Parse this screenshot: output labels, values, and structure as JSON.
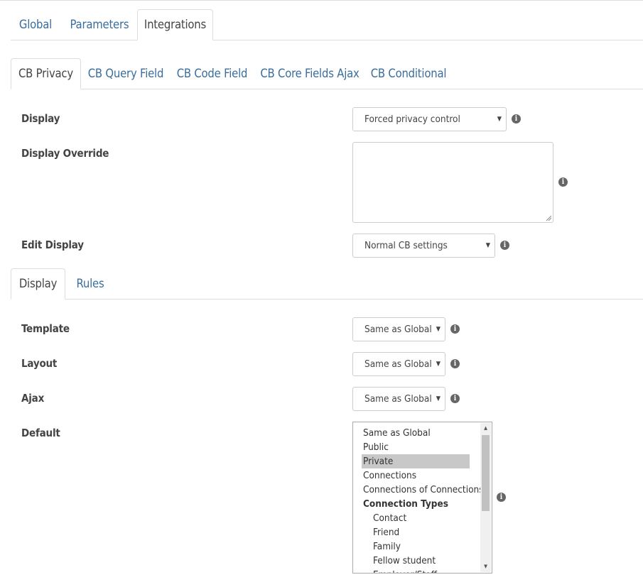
{
  "main_tabs": [
    {
      "label": "Global",
      "active": false
    },
    {
      "label": "Parameters",
      "active": false
    },
    {
      "label": "Integrations",
      "active": true
    }
  ],
  "integration_tabs": [
    {
      "label": "CB Privacy",
      "active": true
    },
    {
      "label": "CB Query Field",
      "active": false
    },
    {
      "label": "CB Code Field",
      "active": false
    },
    {
      "label": "CB Core Fields Ajax",
      "active": false
    },
    {
      "label": "CB Conditional",
      "active": false
    }
  ],
  "privacy": {
    "display_label": "Display",
    "display_value": "Forced privacy control",
    "display_override_label": "Display Override",
    "display_override_value": "",
    "edit_display_label": "Edit Display",
    "edit_display_value": "Normal CB settings"
  },
  "sub_tabs": [
    {
      "label": "Display",
      "active": true
    },
    {
      "label": "Rules",
      "active": false
    }
  ],
  "display_settings": {
    "template_label": "Template",
    "template_value": "Same as Global",
    "layout_label": "Layout",
    "layout_value": "Same as Global",
    "ajax_label": "Ajax",
    "ajax_value": "Same as Global",
    "default_label": "Default",
    "default_options": [
      {
        "label": "Same as Global",
        "type": "option",
        "selected": false
      },
      {
        "label": "Public",
        "type": "option",
        "selected": false
      },
      {
        "label": "Private",
        "type": "option",
        "selected": true
      },
      {
        "label": "Connections",
        "type": "option",
        "selected": false
      },
      {
        "label": "Connections of Connections",
        "type": "option",
        "selected": false
      },
      {
        "label": "Connection Types",
        "type": "group",
        "selected": false
      },
      {
        "label": "Contact",
        "type": "child",
        "selected": false
      },
      {
        "label": "Friend",
        "type": "child",
        "selected": false
      },
      {
        "label": "Family",
        "type": "child",
        "selected": false
      },
      {
        "label": "Fellow student",
        "type": "child",
        "selected": false
      },
      {
        "label": "Employer/Staff",
        "type": "child",
        "selected": false
      }
    ]
  },
  "icons": {
    "info": "info-icon",
    "select_caret": "caret-down-icon",
    "scroll_up": "arrow-up-icon",
    "scroll_down": "arrow-down-icon"
  },
  "info_glyph": "i",
  "caret_glyph": "▼",
  "colors": {
    "link": "#3a6e9e",
    "border": "#dddddd",
    "selected_option": "#c8c8c8"
  }
}
